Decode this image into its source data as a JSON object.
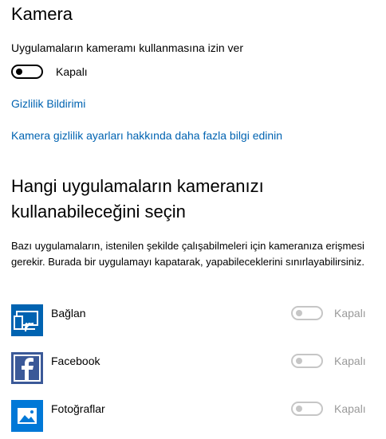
{
  "header": {
    "title": "Kamera"
  },
  "camera_access": {
    "label": "Uygulamaların kameramı kullanmasına izin ver",
    "state_text": "Kapalı",
    "enabled": false
  },
  "links": {
    "privacy_statement": "Gizlilik Bildirimi",
    "learn_more": "Kamera gizlilik ayarları hakkında daha fazla bilgi edinin"
  },
  "apps_section": {
    "title": "Hangi uygulamaların kameranızı kullanabileceğini seçin",
    "description": "Bazı uygulamaların, istenilen şekilde çalışabilmeleri için kameranıza erişmesi gerekir. Burada bir uygulamayı kapatarak, yapabileceklerini sınırlayabilirsiniz.",
    "apps": [
      {
        "name": "Bağlan",
        "state_text": "Kapalı",
        "icon": "connect-icon",
        "icon_color": "#0063b1"
      },
      {
        "name": "Facebook",
        "state_text": "Kapalı",
        "icon": "facebook-icon",
        "icon_color": "#3b5998"
      },
      {
        "name": "Fotoğraflar",
        "state_text": "Kapalı",
        "icon": "photos-icon",
        "icon_color": "#0078d7"
      }
    ]
  },
  "colors": {
    "link": "#0063b1",
    "disabled": "#c6c6c6"
  }
}
